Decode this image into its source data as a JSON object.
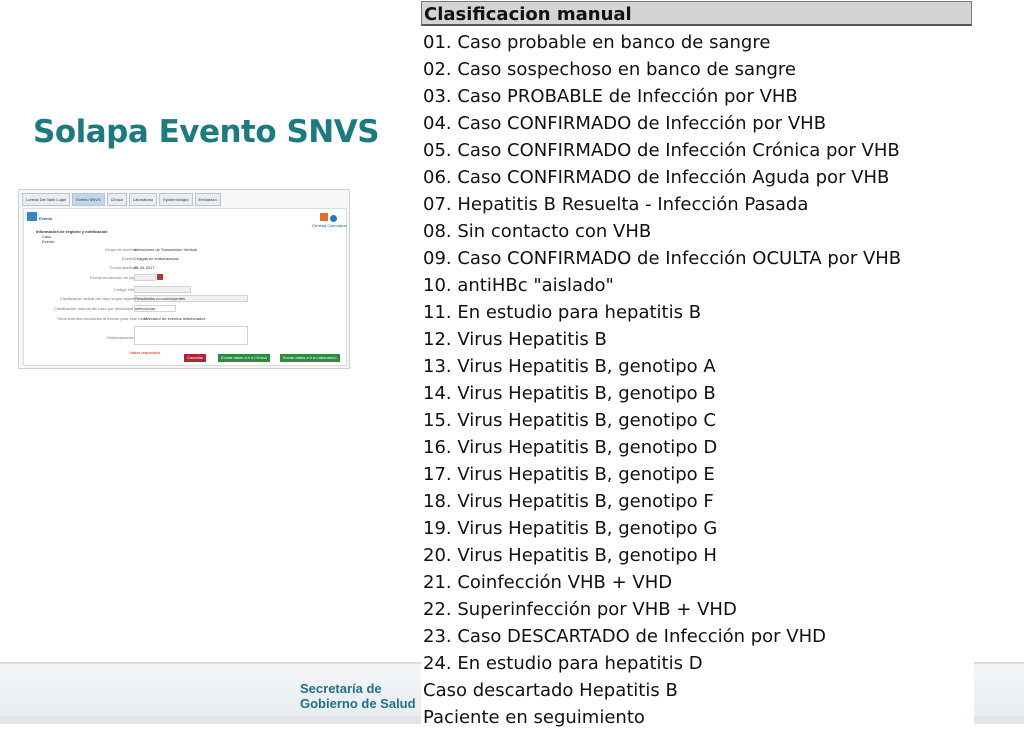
{
  "slide": {
    "title": "Solapa Evento SNVS",
    "brand_line1": "Secretaría de",
    "brand_line2": "Gobierno de Salud"
  },
  "thumb": {
    "tabs": [
      "Lorena Del Valle Lujan",
      "Evento SNVS",
      "Clínica",
      "Laboratorio",
      "Epidemiología",
      "Embarazo"
    ],
    "section_header": "Información de registro y notificación",
    "tree_item_caso": "Caso",
    "tree_item_evento": "Evento",
    "label_grupo": "Grupo de eventos",
    "value_grupo": "Infecciones de Transmisión Vertical",
    "label_evento": "Evento",
    "value_evento": "Chagas en embarazadas",
    "label_fecha_apertura": "Fecha apertura",
    "value_fecha_apertura": "25-09-2017",
    "label_fecha_papel": "Fecha recolección en papel",
    "label_codigo": "Código HIV",
    "label_clasif_actual": "Clasificación actual del caso según algoritmo",
    "value_clasif_actual": "Resultados no concluyentes",
    "label_clasif_manual": "Clasificación manual del caso por necesidad sanitaria",
    "value_clasif_manual": "seleccionar",
    "label_otros": "Otros eventos vinculados al evento para este caso",
    "value_otros": "Marcador de eventos relacionados",
    "label_observaciones": "Observaciones",
    "required_note": "*datos requeridos",
    "general_label": "General Calendario",
    "btn_cancel": "Cancelar",
    "btn_clinica": "Enviar datos a ir a Clínica",
    "btn_lab": "Enviar datos a ir a Laboratorio",
    "section_title": "Evento"
  },
  "classification": {
    "header": "Clasificacion manual",
    "items": [
      "01. Caso probable en banco de sangre",
      "02. Caso sospechoso en banco de sangre",
      "03. Caso PROBABLE de Infección por VHB",
      "04. Caso CONFIRMADO de Infección por VHB",
      "05. Caso CONFIRMADO de Infección Crónica por VHB",
      "06. Caso CONFIRMADO de Infección Aguda por VHB",
      "07. Hepatitis B Resuelta - Infección Pasada",
      "08. Sin contacto con VHB",
      "09. Caso CONFIRMADO de Infección OCULTA por VHB",
      "10. antiHBc \"aislado\"",
      "11. En estudio para hepatitis B",
      "12. Virus Hepatitis B",
      "13. Virus Hepatitis B, genotipo A",
      "14. Virus Hepatitis B, genotipo B",
      "15. Virus Hepatitis B, genotipo C",
      "16. Virus Hepatitis B, genotipo D",
      "17. Virus Hepatitis B, genotipo E",
      "18. Virus Hepatitis B, genotipo F",
      "19. Virus Hepatitis B, genotipo G",
      "20. Virus Hepatitis B, genotipo H",
      "21. Coinfección VHB + VHD",
      "22. Superinfección por VHB + VHD",
      "23. Caso DESCARTADO de Infección por VHD",
      "24. En estudio para hepatitis D",
      "Caso descartado Hepatitis B",
      "Paciente en seguimiento"
    ]
  },
  "colors": {
    "title": "#1f7a80",
    "brand": "#1f6f8b",
    "cancel_button": "#b3223a",
    "send_button": "#2e8b3e"
  }
}
